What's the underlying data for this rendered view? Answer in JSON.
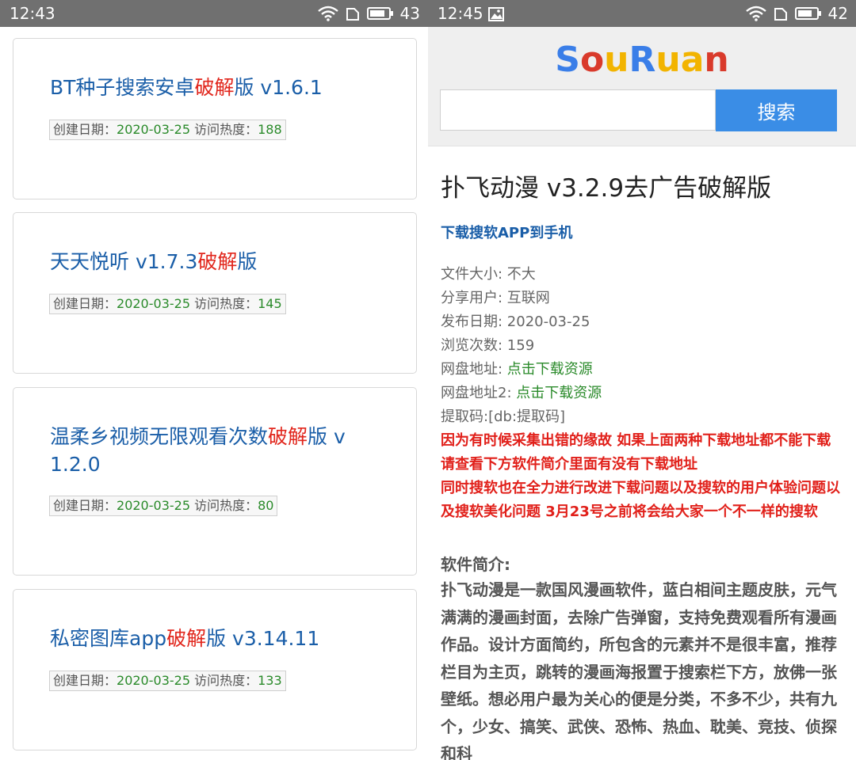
{
  "left": {
    "status": {
      "time": "12:43",
      "battery": "43"
    },
    "items": [
      {
        "title_a": "BT种子搜索安卓",
        "title_hl": "破解",
        "title_b": "版 v1.6.1",
        "date_label": "创建日期：",
        "date": "2020-03-25",
        "hits_label": " 访问热度：",
        "hits": "188"
      },
      {
        "title_a": "天天悦听 v1.7.3",
        "title_hl": "破解",
        "title_b": "版",
        "date_label": "创建日期：",
        "date": "2020-03-25",
        "hits_label": " 访问热度：",
        "hits": "145"
      },
      {
        "title_a": "温柔乡视频无限观看次数",
        "title_hl": "破解",
        "title_b": "版 v 1.2.0",
        "date_label": "创建日期：",
        "date": "2020-03-25",
        "hits_label": " 访问热度：",
        "hits": "80"
      },
      {
        "title_a": "私密图库app",
        "title_hl": "破解",
        "title_b": "版 v3.14.11",
        "date_label": "创建日期：",
        "date": "2020-03-25",
        "hits_label": " 访问热度：",
        "hits": "133"
      }
    ]
  },
  "right": {
    "status": {
      "time": "12:45",
      "battery": "42"
    },
    "logo": {
      "letters": [
        "S",
        "o",
        "u",
        "R",
        "u",
        "a",
        "n"
      ],
      "colors": [
        "#3a7ee8",
        "#d93a2b",
        "#f2b400",
        "#3a7ee8",
        "#f2b400",
        "#f2b400",
        "#d93a2b"
      ]
    },
    "search": {
      "value": "",
      "button_label": "搜索"
    },
    "title": "扑飞动漫 v3.2.9去广告破解版",
    "download_app": "下载搜软APP到手机",
    "info": {
      "size_label": "文件大小: ",
      "size": "不大",
      "user_label": "分享用户: ",
      "user": "互联网",
      "date_label": "发布日期: ",
      "date": "2020-03-25",
      "views_label": "浏览次数: ",
      "views": "159",
      "disk_label": "网盘地址: ",
      "disk_link": "点击下载资源",
      "disk2_label": "网盘地址2: ",
      "disk2_link": "点击下载资源",
      "code": "提取码:[db:提取码]"
    },
    "notice1": "因为有时候采集出错的缘故 如果上面两种下载地址都不能下载 请查看下方软件简介里面有没有下载地址",
    "notice2": "同时搜软也在全力进行改进下载问题以及搜软的用户体验问题以及搜软美化问题 3月23号之前将会给大家一个不一样的搜软",
    "intro_heading": "软件简介:",
    "intro_body": "扑飞动漫是一款国风漫画软件，蓝白相间主题皮肤，元气满满的漫画封面，去除广告弹窗，支持免费观看所有漫画作品。设计方面简约，所包含的元素并不是很丰富，推荐栏目为主页，跳转的漫画海报置于搜索栏下方，放佛一张壁纸。想必用户最为关心的便是分类，不多不少，共有九个，少女、搞笑、武侠、恐怖、热血、耽美、竞技、侦探和科"
  }
}
